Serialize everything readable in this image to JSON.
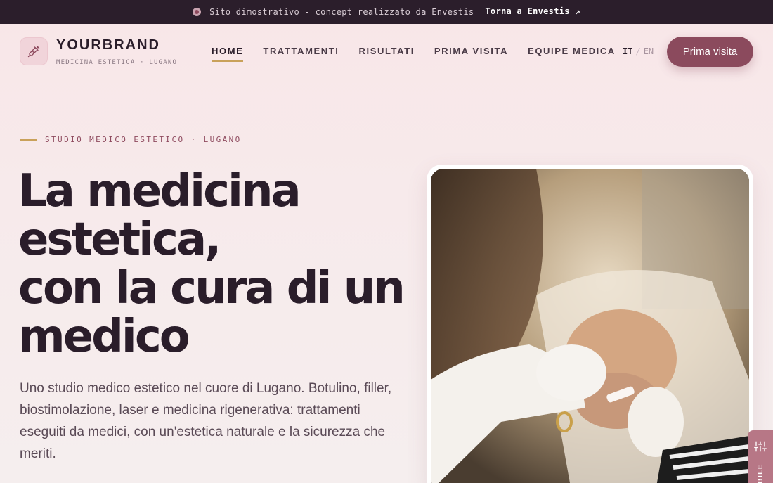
{
  "topbar": {
    "message": "Sito dimostrativo - concept realizzato da Envestis",
    "back_link": "Torna a Envestis ↗"
  },
  "brand": {
    "name": "YOURBRAND",
    "tagline": "MEDICINA ESTETICA · LUGANO"
  },
  "nav": {
    "items": [
      {
        "label": "HOME",
        "active": true
      },
      {
        "label": "TRATTAMENTI"
      },
      {
        "label": "RISULTATI"
      },
      {
        "label": "PRIMA VISITA"
      },
      {
        "label": "EQUIPE MEDICA"
      }
    ]
  },
  "lang": {
    "active": "IT",
    "separator": "/",
    "other": "EN"
  },
  "cta": {
    "label": "Prima visita"
  },
  "hero": {
    "eyebrow": "STUDIO MEDICO ESTETICO · LUGANO",
    "headline_lines": [
      "La medicina",
      "estetica,",
      "con la cura di un",
      "medico"
    ],
    "lead": "Uno studio medico estetico nel cuore di Lugano. Botulino, filler, biostimolazione, laser e medicina rigenerativa: trattamenti eseguiti da medici, con un'estetica naturale e la sicurezza che meriti."
  },
  "side_tab": {
    "label": "BILE"
  },
  "colors": {
    "accent": "#8b4a5d",
    "gold": "#c9a15a",
    "dark": "#2b1e2b"
  }
}
